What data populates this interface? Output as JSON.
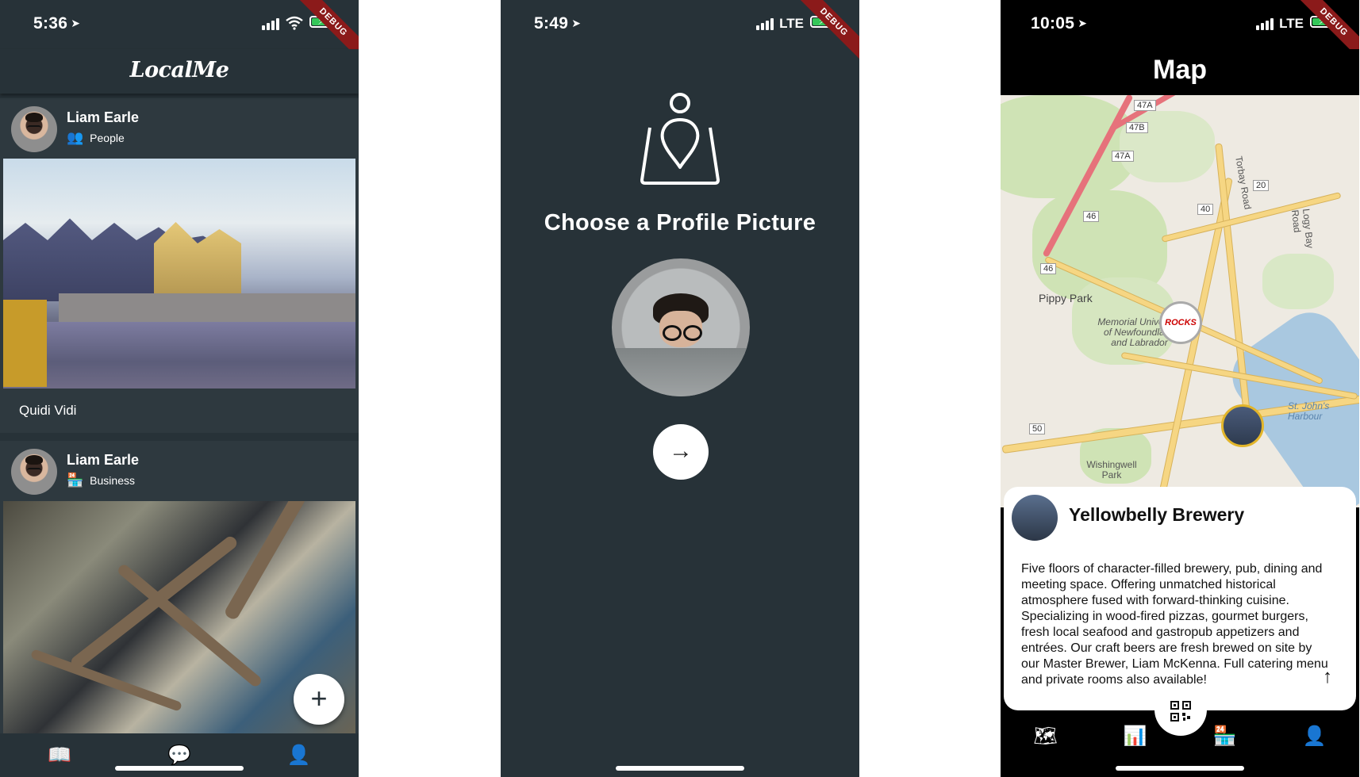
{
  "screens": [
    {
      "time": "5:36",
      "network": "",
      "debug": "DEBUG",
      "app_title": "LocalMe",
      "posts": [
        {
          "author": "Liam Earle",
          "type": "People",
          "type_icon": "people-icon",
          "caption": "Quidi Vidi"
        },
        {
          "author": "Liam Earle",
          "type": "Business",
          "type_icon": "store-icon",
          "caption": ""
        }
      ],
      "fab_icon": "plus-icon",
      "nav": [
        "map-book-icon",
        "chat-icon",
        "person-icon"
      ]
    },
    {
      "time": "5:49",
      "network": "LTE",
      "debug": "DEBUG",
      "title": "Choose a Profile Picture",
      "next_icon": "arrow-right-icon"
    },
    {
      "time": "10:05",
      "network": "LTE",
      "debug": "DEBUG",
      "title": "Map",
      "map_labels": [
        "Pippy Park",
        "Memorial University of Newfoundland and Labrador",
        "St. John's Harbour",
        "Wishingwell Park",
        "Torbay Road",
        "Logy Bay Road"
      ],
      "road_shields": [
        "47A",
        "47B",
        "47A",
        "20",
        "40",
        "46",
        "46",
        "50"
      ],
      "marker_text": "ROCKS",
      "place": {
        "name": "Yellowbelly Brewery",
        "description": "Five floors of character-filled brewery, pub, dining and meeting space. Offering unmatched historical atmosphere fused with forward-thinking cuisine. Specializing in wood-fired pizzas, gourmet burgers, fresh local seafood and gastropub appetizers and entrées. Our craft beers are fresh brewed on site by our Master Brewer, Liam McKenna. Full catering menu and private rooms also available!"
      },
      "nav": [
        "map-icon",
        "chart-icon",
        "store-icon",
        "person-icon"
      ]
    }
  ],
  "colors": {
    "app_bg": "#273238",
    "card_bg": "#2e393f",
    "debug_banner": "#8b1a1a",
    "battery": "#34c759",
    "marker_gold": "#e2b52a"
  }
}
